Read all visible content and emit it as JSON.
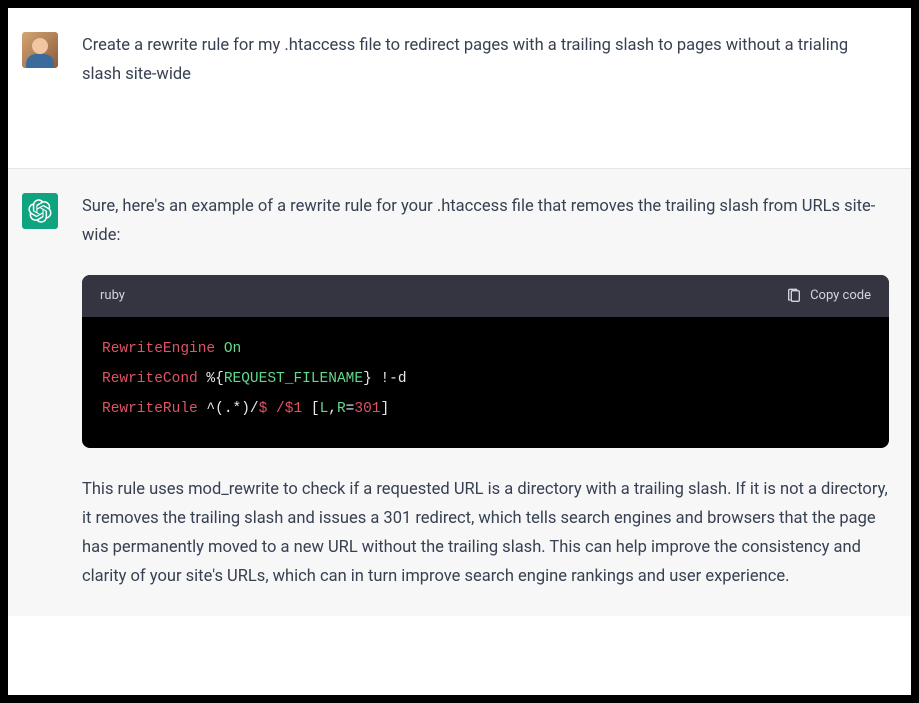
{
  "user_message": {
    "text": "Create a rewrite rule for my .htaccess file to redirect pages with a trailing slash to pages without a trialing slash site-wide"
  },
  "assistant_message": {
    "intro": "Sure, here's an example of a rewrite rule for your .htaccess file that removes the trailing slash from URLs site-wide:",
    "code": {
      "language": "ruby",
      "copy_label": "Copy code",
      "tokens": {
        "t1": "RewriteEngine",
        "t2": " On",
        "t3": "RewriteCond",
        "t4": " %{",
        "t5": "REQUEST_FILENAME",
        "t6": "}",
        "t7": " !-d",
        "t8": "RewriteRule",
        "t9": " ^(.*)/",
        "t10": "$ /",
        "t11": "$1",
        "t12": " [",
        "t13": "L",
        "t14": ",",
        "t15": "R",
        "t16": "=",
        "t17": "301",
        "t18": "]"
      }
    },
    "explanation": "This rule uses mod_rewrite to check if a requested URL is a directory with a trailing slash. If it is not a directory, it removes the trailing slash and issues a 301 redirect, which tells search engines and browsers that the page has permanently moved to a new URL without the trailing slash. This can help improve the consistency and clarity of your site's URLs, which can in turn improve search engine rankings and user experience."
  }
}
